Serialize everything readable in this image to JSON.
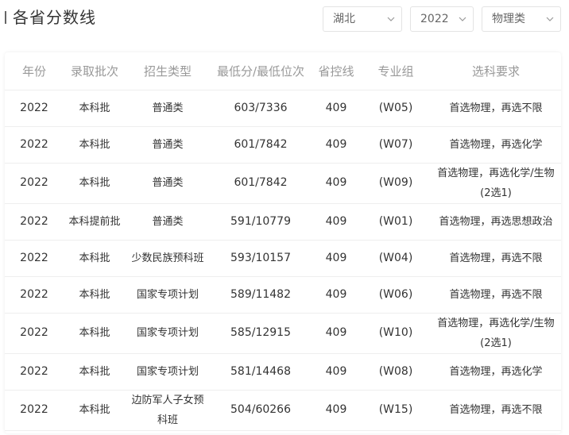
{
  "page": {
    "title": "各省分数线"
  },
  "filters": {
    "province": "湖北",
    "year": "2022",
    "subject_type": "物理类"
  },
  "table": {
    "headers": [
      "年份",
      "录取批次",
      "招生类型",
      "最低分/最低位次",
      "省控线",
      "专业组",
      "选科要求"
    ],
    "rows": [
      [
        "2022",
        "本科批",
        "普通类",
        "603/7336",
        "409",
        "(W05)",
        "首选物理，再选不限"
      ],
      [
        "2022",
        "本科批",
        "普通类",
        "601/7842",
        "409",
        "(W07)",
        "首选物理，再选化学"
      ],
      [
        "2022",
        "本科批",
        "普通类",
        "601/7842",
        "409",
        "(W09)",
        "首选物理，再选化学/生物(2选1)"
      ],
      [
        "2022",
        "本科提前批",
        "普通类",
        "591/10779",
        "409",
        "(W01)",
        "首选物理，再选思想政治"
      ],
      [
        "2022",
        "本科批",
        "少数民族预科班",
        "593/10157",
        "409",
        "(W04)",
        "首选物理，再选不限"
      ],
      [
        "2022",
        "本科批",
        "国家专项计划",
        "589/11482",
        "409",
        "(W06)",
        "首选物理，再选不限"
      ],
      [
        "2022",
        "本科批",
        "国家专项计划",
        "585/12915",
        "409",
        "(W10)",
        "首选物理，再选化学/生物(2选1)"
      ],
      [
        "2022",
        "本科批",
        "国家专项计划",
        "581/14468",
        "409",
        "(W08)",
        "首选物理，再选化学"
      ],
      [
        "2022",
        "本科批",
        "边防军人子女预科班",
        "504/60266",
        "409",
        "(W15)",
        "首选物理，再选不限"
      ]
    ]
  },
  "icons": {
    "dropdown": "chevron-down-icon"
  }
}
